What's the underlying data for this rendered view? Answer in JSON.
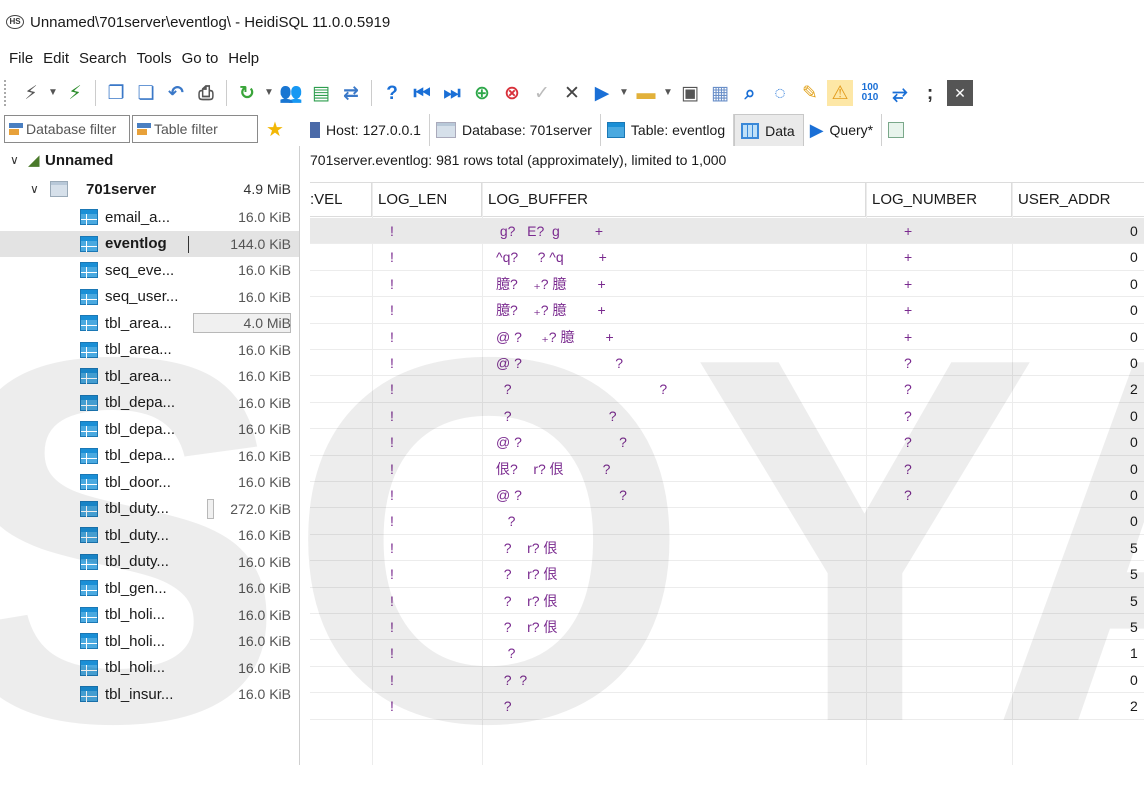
{
  "window": {
    "app_icon_text": "HS",
    "title": "Unnamed\\701server\\eventlog\\ - HeidiSQL 11.0.0.5919"
  },
  "menu": [
    "File",
    "Edit",
    "Search",
    "Tools",
    "Go to",
    "Help"
  ],
  "filters": {
    "database_filter_placeholder": "Database filter",
    "table_filter_placeholder": "Table filter"
  },
  "tree": {
    "session": "Unnamed",
    "database": {
      "name": "701server",
      "size": "4.9 MiB"
    },
    "tables": [
      {
        "name": "email_a...",
        "size": "16.0 KiB"
      },
      {
        "name": "eventlog",
        "size": "144.0 KiB"
      },
      {
        "name": "seq_eve...",
        "size": "16.0 KiB"
      },
      {
        "name": "seq_user...",
        "size": "16.0 KiB"
      },
      {
        "name": "tbl_area...",
        "size": "4.0 MiB"
      },
      {
        "name": "tbl_area...",
        "size": "16.0 KiB"
      },
      {
        "name": "tbl_area...",
        "size": "16.0 KiB"
      },
      {
        "name": "tbl_depa...",
        "size": "16.0 KiB"
      },
      {
        "name": "tbl_depa...",
        "size": "16.0 KiB"
      },
      {
        "name": "tbl_depa...",
        "size": "16.0 KiB"
      },
      {
        "name": "tbl_door...",
        "size": "16.0 KiB"
      },
      {
        "name": "tbl_duty...",
        "size": "272.0 KiB"
      },
      {
        "name": "tbl_duty...",
        "size": "16.0 KiB"
      },
      {
        "name": "tbl_duty...",
        "size": "16.0 KiB"
      },
      {
        "name": "tbl_gen...",
        "size": "16.0 KiB"
      },
      {
        "name": "tbl_holi...",
        "size": "16.0 KiB"
      },
      {
        "name": "tbl_holi...",
        "size": "16.0 KiB"
      },
      {
        "name": "tbl_holi...",
        "size": "16.0 KiB"
      },
      {
        "name": "tbl_insur...",
        "size": "16.0 KiB"
      }
    ]
  },
  "tabs": [
    {
      "label": "Host: 127.0.0.1",
      "icon": "host-icon"
    },
    {
      "label": "Database: 701server",
      "icon": "database-icon"
    },
    {
      "label": "Table: eventlog",
      "icon": "table-icon"
    },
    {
      "label": "Data",
      "icon": "grid-icon"
    },
    {
      "label": "Query*",
      "icon": "play-icon"
    },
    {
      "label": "",
      "icon": "new-query-icon"
    }
  ],
  "status": "701server.eventlog: 981 rows total (approximately), limited to 1,000",
  "grid": {
    "columns": [
      ":VEL",
      "LOG_LEN",
      "LOG_BUFFER",
      "LOG_NUMBER",
      "USER_ADDR"
    ],
    "rows": [
      {
        "log_len": "!",
        "buffer": " g?   E?  g         +",
        "number": "+",
        "user": "0"
      },
      {
        "log_len": "!",
        "buffer": "^q?     ? ^q         +",
        "number": "+",
        "user": "0"
      },
      {
        "log_len": "!",
        "buffer": "臆?    ₊? 臆        +",
        "number": "+",
        "user": "0"
      },
      {
        "log_len": "!",
        "buffer": "臆?    ₊? 臆        +",
        "number": "+",
        "user": "0"
      },
      {
        "log_len": "!",
        "buffer": "@ ?     ₊? 臆        +",
        "number": "+",
        "user": "0"
      },
      {
        "log_len": "!",
        "buffer": "@ ?                        ?",
        "number": "?",
        "user": "0"
      },
      {
        "log_len": "!",
        "buffer": "  ?                                      ?",
        "number": "?",
        "user": "2"
      },
      {
        "log_len": "!",
        "buffer": "  ?                         ?",
        "number": "?",
        "user": "0"
      },
      {
        "log_len": "!",
        "buffer": "@ ?                         ?",
        "number": "?",
        "user": "0"
      },
      {
        "log_len": "!",
        "buffer": "佷?    r? 佷          ?",
        "number": "?",
        "user": "0"
      },
      {
        "log_len": "!",
        "buffer": "@ ?                         ?",
        "number": "?",
        "user": "0"
      },
      {
        "log_len": "!",
        "buffer": "   ?",
        "number": "",
        "user": "0"
      },
      {
        "log_len": "!",
        "buffer": "  ?    r? 佷",
        "number": "",
        "user": "5"
      },
      {
        "log_len": "!",
        "buffer": "  ?    r? 佷",
        "number": "",
        "user": "5"
      },
      {
        "log_len": "!",
        "buffer": "  ?    r? 佷",
        "number": "",
        "user": "5"
      },
      {
        "log_len": "!",
        "buffer": "  ?    r? 佷",
        "number": "",
        "user": "5"
      },
      {
        "log_len": "!",
        "buffer": "   ?",
        "number": "",
        "user": "1"
      },
      {
        "log_len": "!",
        "buffer": "  ?  ?",
        "number": "",
        "user": "0"
      },
      {
        "log_len": "!",
        "buffer": "  ?",
        "number": "",
        "user": "2"
      }
    ]
  },
  "colors": {
    "accent_blue": "#1a8fd6",
    "cell_text": "#7a2a8f",
    "selected_row": "#e9e9e9"
  }
}
